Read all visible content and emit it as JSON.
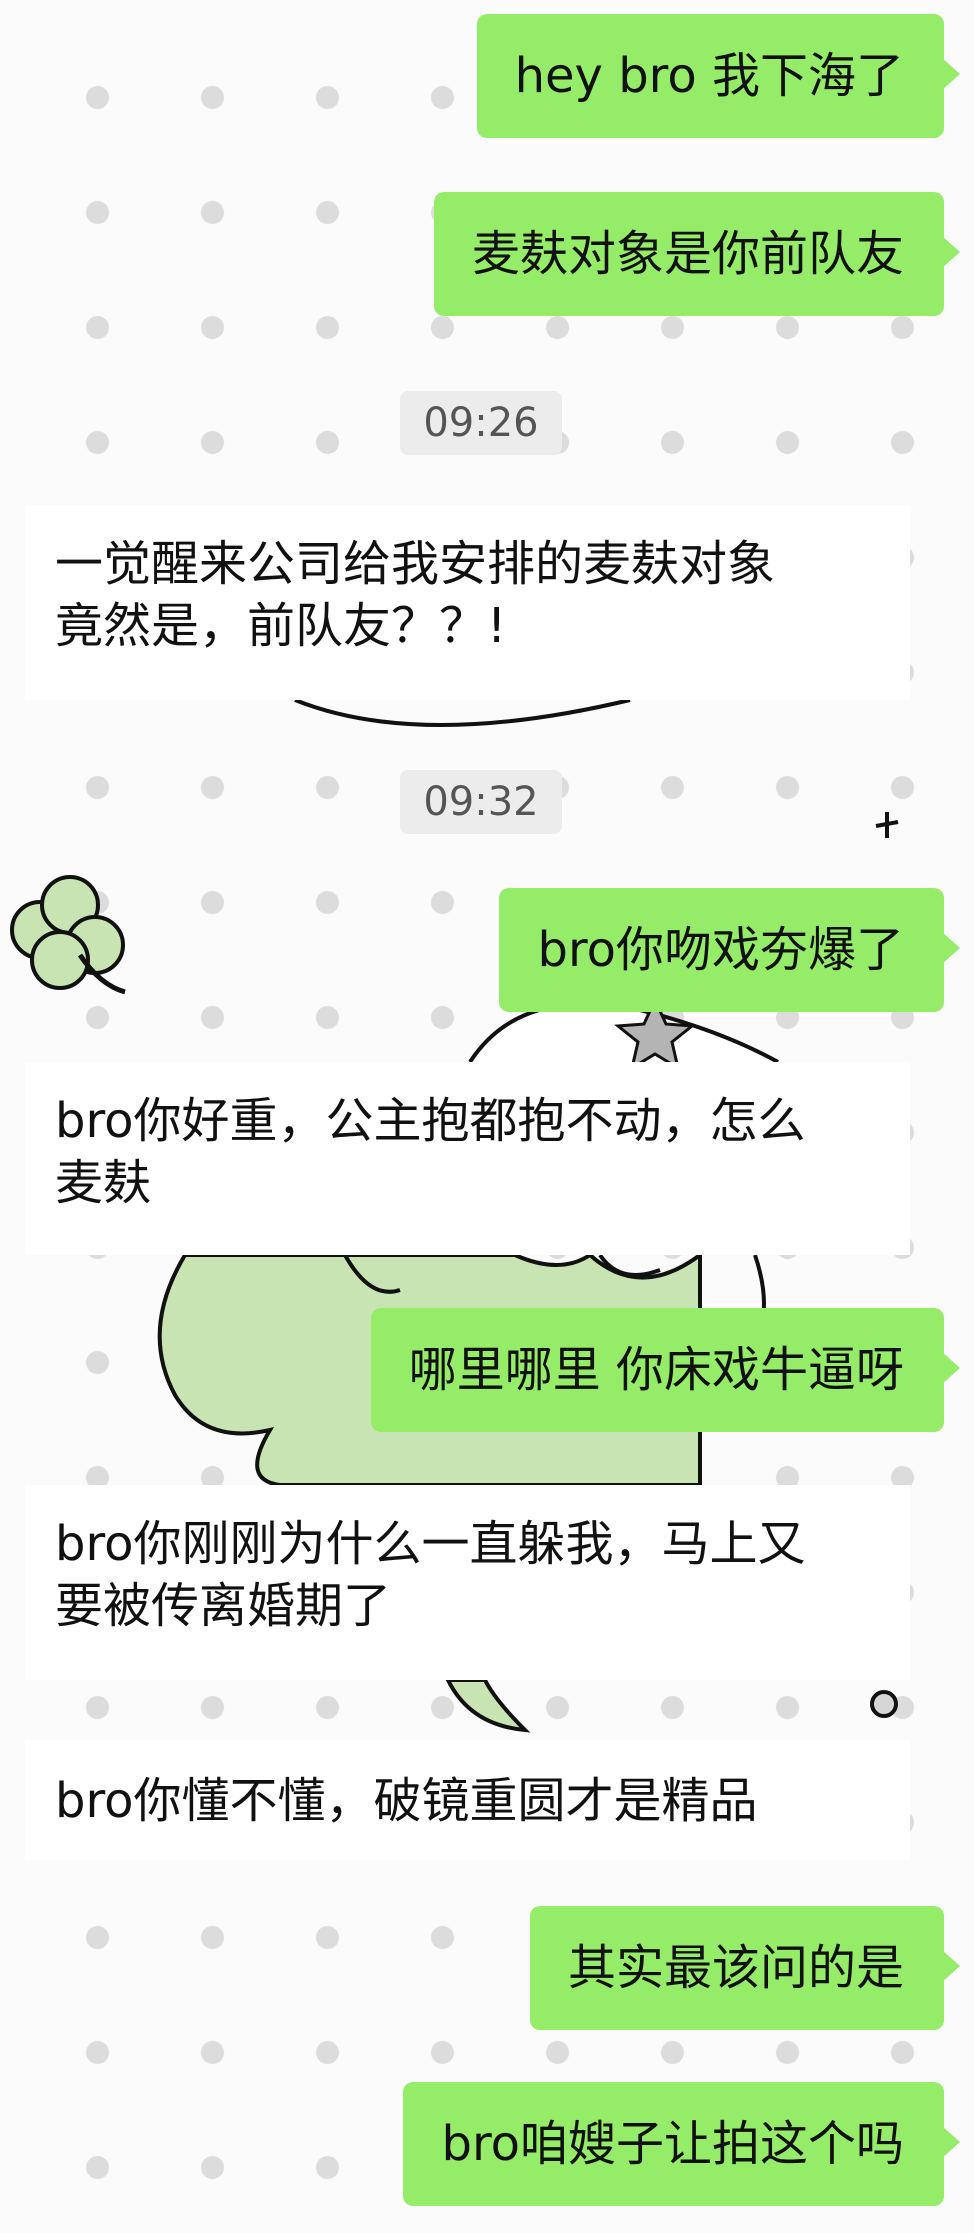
{
  "chat": {
    "messages": {
      "m1": "hey bro 我下海了",
      "m2": "麦麸对象是你前队友",
      "m3_line1": "一觉醒来公司给我安排的麦麸对象",
      "m3_line2": "竟然是，前队友？？!",
      "m4": "bro你吻戏夯爆了",
      "m5_line1": "bro你好重，公主抱都抱不动，怎么",
      "m5_line2": "麦麸",
      "m6": "哪里哪里 你床戏牛逼呀",
      "m7_line1": "bro你刚刚为什么一直躲我，马上又",
      "m7_line2": "要被传离婚期了",
      "m8": "bro你懂不懂，破镜重圆才是精品",
      "m9": "其实最该问的是",
      "m10": "bro咱嫂子让拍这个吗"
    },
    "timestamps": {
      "t1": "09:26",
      "t2": "09:32"
    }
  },
  "colors": {
    "sent_bubble": "#95ec69",
    "background": "#fbfbfb",
    "dots": "#dcdcdc",
    "clover": "#c8e4b2"
  },
  "decorations": [
    "clover-icon",
    "cartoon-cat-doodle",
    "star-icon",
    "sparkle-icon"
  ]
}
